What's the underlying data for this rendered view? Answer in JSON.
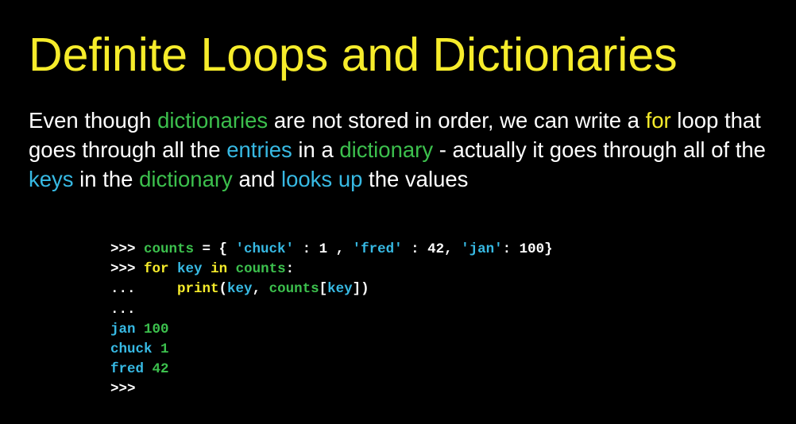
{
  "colors": {
    "background": "#000000",
    "title": "#f6ec2b",
    "text": "#ffffff",
    "green": "#3cc04d",
    "cyan": "#37b9e3",
    "yellow": "#f6ec2b"
  },
  "title": "Definite Loops and Dictionaries",
  "paragraph": [
    {
      "text": "Even though ",
      "color": "white"
    },
    {
      "text": "dictionaries",
      "color": "green"
    },
    {
      "text": " are not stored in order, we can write a ",
      "color": "white"
    },
    {
      "text": "for",
      "color": "yellow"
    },
    {
      "text": " loop that goes through all the ",
      "color": "white"
    },
    {
      "text": "entries",
      "color": "cyan"
    },
    {
      "text": " in a ",
      "color": "white"
    },
    {
      "text": "dictionary",
      "color": "green"
    },
    {
      "text": " - actually it goes through all of the ",
      "color": "white"
    },
    {
      "text": "keys",
      "color": "cyan"
    },
    {
      "text": " in the ",
      "color": "white"
    },
    {
      "text": "dictionary",
      "color": "green"
    },
    {
      "text": " and ",
      "color": "white"
    },
    {
      "text": "looks up",
      "color": "cyan"
    },
    {
      "text": " the values",
      "color": "white"
    }
  ],
  "code_lines": [
    [
      {
        "text": ">>> ",
        "color": "white"
      },
      {
        "text": "counts",
        "color": "green"
      },
      {
        "text": " = { ",
        "color": "white"
      },
      {
        "text": "'chuck'",
        "color": "cyan"
      },
      {
        "text": " : 1 , ",
        "color": "white"
      },
      {
        "text": "'fred'",
        "color": "cyan"
      },
      {
        "text": " : 42, ",
        "color": "white"
      },
      {
        "text": "'jan'",
        "color": "cyan"
      },
      {
        "text": ": 100}",
        "color": "white"
      }
    ],
    [
      {
        "text": ">>> ",
        "color": "white"
      },
      {
        "text": "for",
        "color": "yellow"
      },
      {
        "text": " ",
        "color": "white"
      },
      {
        "text": "key",
        "color": "cyan"
      },
      {
        "text": " ",
        "color": "white"
      },
      {
        "text": "in",
        "color": "yellow"
      },
      {
        "text": " ",
        "color": "white"
      },
      {
        "text": "counts",
        "color": "green"
      },
      {
        "text": ":",
        "color": "white"
      }
    ],
    [
      {
        "text": "...     ",
        "color": "white"
      },
      {
        "text": "print",
        "color": "yellow"
      },
      {
        "text": "(",
        "color": "white"
      },
      {
        "text": "key",
        "color": "cyan"
      },
      {
        "text": ", ",
        "color": "white"
      },
      {
        "text": "counts",
        "color": "green"
      },
      {
        "text": "[",
        "color": "white"
      },
      {
        "text": "key",
        "color": "cyan"
      },
      {
        "text": "])",
        "color": "white"
      }
    ],
    [
      {
        "text": "...",
        "color": "white"
      }
    ],
    [
      {
        "text": "jan",
        "color": "cyan"
      },
      {
        "text": " 100",
        "color": "green"
      }
    ],
    [
      {
        "text": "chuck",
        "color": "cyan"
      },
      {
        "text": " 1",
        "color": "green"
      }
    ],
    [
      {
        "text": "fred",
        "color": "cyan"
      },
      {
        "text": " 42",
        "color": "green"
      }
    ],
    [
      {
        "text": ">>>",
        "color": "white"
      }
    ]
  ]
}
